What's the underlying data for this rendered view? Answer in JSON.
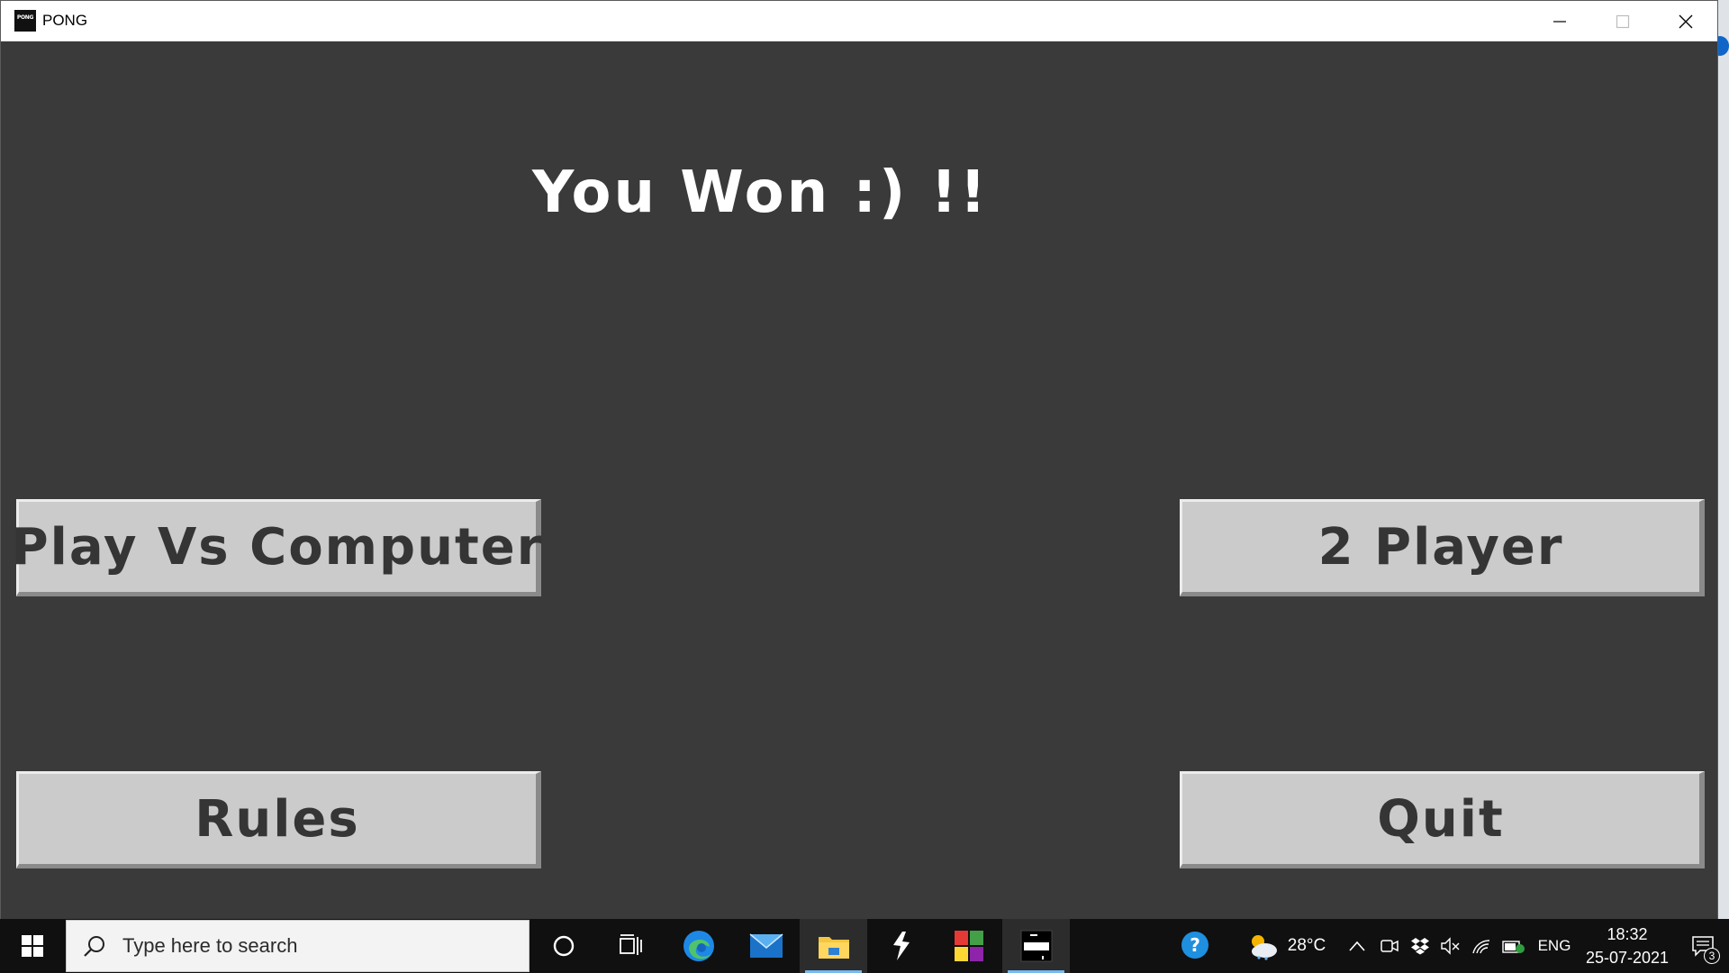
{
  "window": {
    "title": "PONG",
    "app_icon_label": "PONG"
  },
  "game": {
    "result_message": "You Won :) !!",
    "buttons": {
      "play_vs_computer": "Play Vs Computer",
      "two_player": "2 Player",
      "rules": "Rules",
      "quit": "Quit"
    }
  },
  "taskbar": {
    "search_placeholder": "Type here to search",
    "pinned_icons": [
      "cortana-icon",
      "task-view-icon",
      "edge-icon",
      "mail-icon",
      "file-explorer-icon",
      "app-bolt-icon",
      "color-grid-icon",
      "pong-icon"
    ],
    "tray": {
      "temperature": "28°C",
      "language": "ENG",
      "time": "18:32",
      "date": "25-07-2021",
      "notification_count": "3"
    }
  },
  "colors": {
    "game_background": "#3a3a3a",
    "button_face": "#cbcbcb",
    "button_text": "#353535",
    "headline_text": "#ffffff",
    "taskbar_background": "#101010",
    "taskbar_active_indicator": "#76b9ed"
  }
}
